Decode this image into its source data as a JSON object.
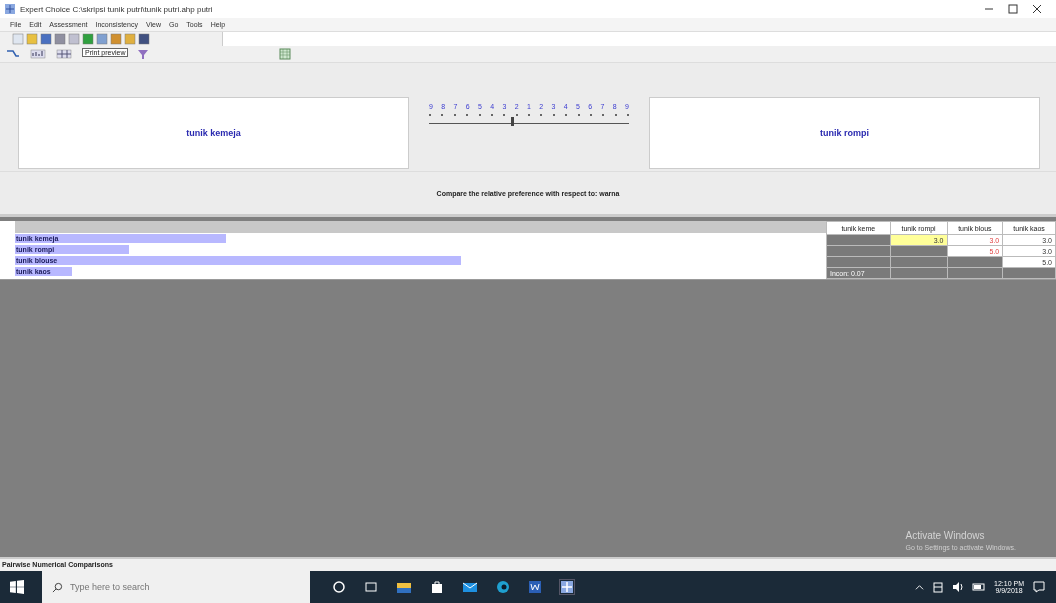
{
  "window": {
    "title": "Expert Choice   C:\\skripsi tunik putri\\tunik putri.ahp   putri"
  },
  "menu": [
    "File",
    "Edit",
    "Assessment",
    "Inconsistency",
    "View",
    "Go",
    "Tools",
    "Help"
  ],
  "tooltip": "Print preview",
  "comparison": {
    "left": "tunik kemeja",
    "right": "tunik rompi",
    "scale": [
      "9",
      "8",
      "7",
      "6",
      "5",
      "4",
      "3",
      "2",
      "1",
      "2",
      "3",
      "4",
      "5",
      "6",
      "7",
      "8",
      "9"
    ],
    "level": 0.41
  },
  "prompt": "Compare the relative preference with respect to: warna",
  "bars": [
    {
      "label": "tunik kemeja",
      "level": 0.26
    },
    {
      "label": "tunik rompi",
      "level": 0.14
    },
    {
      "label": "tunik blouse",
      "level": 0.55
    },
    {
      "label": "tunik kaos",
      "level": 0.07
    }
  ],
  "matrix": {
    "columns": [
      "tunik keme",
      "tunik rompi",
      "tunik blous",
      "tunik kaos"
    ],
    "rows": [
      [
        {
          "kind": "blank"
        },
        {
          "kind": "value",
          "value": "3.0",
          "inverted": false,
          "selected": true
        },
        {
          "kind": "value",
          "value": "3.0",
          "inverted": true,
          "selected": false
        },
        {
          "kind": "value",
          "value": "3.0",
          "inverted": false,
          "selected": false
        }
      ],
      [
        {
          "kind": "blank"
        },
        {
          "kind": "blank"
        },
        {
          "kind": "value",
          "value": "5.0",
          "inverted": true,
          "selected": false
        },
        {
          "kind": "value",
          "value": "3.0",
          "inverted": false,
          "selected": false
        }
      ],
      [
        {
          "kind": "blank"
        },
        {
          "kind": "blank"
        },
        {
          "kind": "blank"
        },
        {
          "kind": "value",
          "value": "5.0",
          "inverted": false,
          "selected": false
        }
      ],
      [
        {
          "kind": "incon",
          "value": "Incon: 0.07"
        },
        {
          "kind": "blank"
        },
        {
          "kind": "blank"
        },
        {
          "kind": "blank"
        }
      ]
    ]
  },
  "activation": {
    "title": "Activate Windows",
    "text": "Go to Settings to activate Windows."
  },
  "status_bar": "Pairwise Numerical Comparisons",
  "taskbar": {
    "search_placeholder": "Type here to search",
    "time": "12:10 PM",
    "date": "9/9/2018"
  }
}
